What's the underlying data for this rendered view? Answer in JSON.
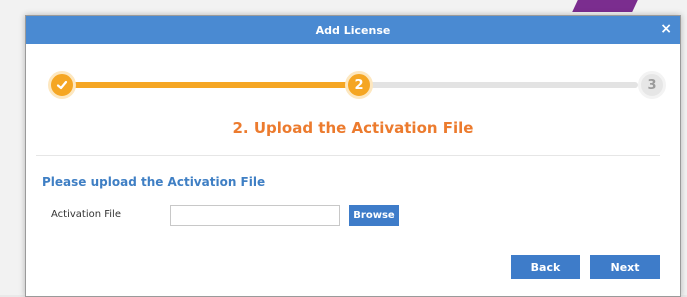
{
  "dialog": {
    "title": "Add License",
    "close_glyph": "×"
  },
  "stepper": {
    "steps": [
      {
        "number": "1",
        "state": "done",
        "icon": "check-icon"
      },
      {
        "number": "2",
        "state": "active"
      },
      {
        "number": "3",
        "state": "pending"
      }
    ],
    "current_step_title": "2. Upload the Activation File"
  },
  "upload": {
    "heading": "Please upload the Activation File",
    "field_label": "Activation File",
    "file_value": "",
    "browse_label": "Browse"
  },
  "footer": {
    "back_label": "Back",
    "next_label": "Next"
  },
  "colors": {
    "title_bar": "#4a8ad2",
    "accent_orange": "#f5a623",
    "step_title": "#ec7b2e",
    "button_blue": "#3e7cc9",
    "heading_blue": "#3f7fc4"
  }
}
